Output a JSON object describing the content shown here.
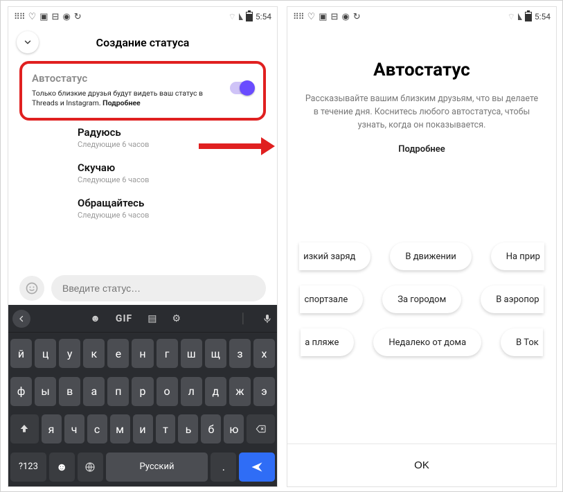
{
  "statusbar": {
    "time": "5:54"
  },
  "left": {
    "header_title": "Создание статуса",
    "card": {
      "title": "Автостатус",
      "desc_a": "Только близкие друзья будут видеть ваш статус в Threads и Instagram. ",
      "desc_b": "Подробнее"
    },
    "items": [
      {
        "t": "Радуюсь",
        "s": "Следующие 6 часов"
      },
      {
        "t": "Скучаю",
        "s": "Следующие 6 часов"
      },
      {
        "t": "Обращайтесь",
        "s": "Следующие 6 часов"
      }
    ],
    "input_placeholder": "Введите статус…",
    "keyboard": {
      "gif": "GIF",
      "row1": [
        "й",
        "ц",
        "у",
        "к",
        "е",
        "н",
        "г",
        "ш",
        "щ",
        "з",
        "х"
      ],
      "row2": [
        "ф",
        "ы",
        "в",
        "а",
        "п",
        "р",
        "о",
        "л",
        "д",
        "ж",
        "э"
      ],
      "row3_letters": [
        "я",
        "ч",
        "с",
        "м",
        "и",
        "т",
        "ь",
        "б",
        "ю"
      ],
      "sym": "?123",
      "lang": "Русский"
    }
  },
  "right": {
    "title": "Автостатус",
    "desc": "Рассказывайте вашим близким друзьям, что вы делаете в течение дня. Коснитесь любого автостатуса, чтобы узнать, когда он показывается.",
    "more": "Подробнее",
    "chips": {
      "r1": [
        "изкий заряд",
        "В движении",
        "На прир"
      ],
      "r2": [
        "спортзале",
        "За городом",
        "В аэропор"
      ],
      "r3": [
        "а пляже",
        "Недалеко от дома",
        "В Ток"
      ]
    },
    "ok": "OK"
  }
}
